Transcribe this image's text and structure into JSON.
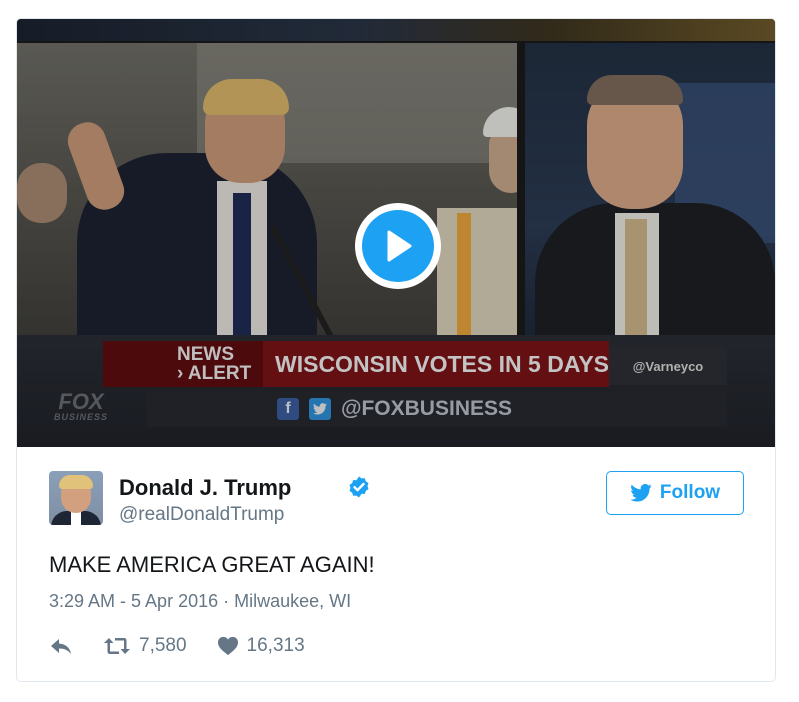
{
  "media": {
    "news_alert": [
      "NEWS",
      "› ALERT"
    ],
    "headline": "WISCONSIN VOTES IN 5 DAYS",
    "show_handle": "@Varneyco",
    "social_handle": "@FOXBUSINESS",
    "network_logo": "FOX",
    "network_sub": "BUSINESS",
    "play_icon": "play-icon"
  },
  "author": {
    "name": "Donald J. Trump",
    "screen_name": "@realDonaldTrump",
    "verified_icon": "verified-badge-icon"
  },
  "follow": {
    "label": "Follow",
    "icon": "twitter-bird-icon"
  },
  "tweet": {
    "text": "MAKE AMERICA GREAT AGAIN!",
    "timestamp": "3:29 AM - 5 Apr 2016",
    "separator": " · ",
    "location": "Milwaukee, WI"
  },
  "actions": {
    "reply_icon": "reply-icon",
    "retweet_icon": "retweet-icon",
    "retweet_count": "7,580",
    "like_icon": "heart-icon",
    "like_count": "16,313"
  },
  "colors": {
    "accent": "#1da1f2",
    "text": "#14171a",
    "muted": "#657786",
    "border": "#e1e8ed"
  }
}
